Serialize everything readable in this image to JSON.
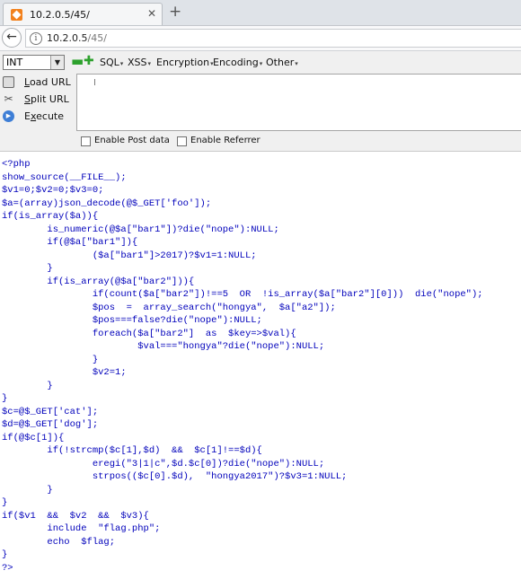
{
  "tab": {
    "title": "10.2.0.5/45/",
    "close_glyph": "✕",
    "new_tab_glyph": "+",
    "icon": "site-favicon"
  },
  "nav": {
    "back_glyph": "←",
    "info_glyph": "i",
    "url_host": "10.2.0.5",
    "url_path": "/45/"
  },
  "hackbar": {
    "select_value": "INT",
    "select_arrow": "▼",
    "minus_glyph": "▬",
    "plus_glyph": "✚",
    "menus": [
      {
        "label": "SQL",
        "caret": "▾"
      },
      {
        "label": "XSS",
        "caret": "▾"
      },
      {
        "label": "Encryption",
        "caret": "▾"
      },
      {
        "label": "Encoding",
        "caret": "▾"
      },
      {
        "label": "Other",
        "caret": "▾"
      }
    ],
    "load_url": {
      "u": "L",
      "rest": "oad URL"
    },
    "split_url": {
      "u": "S",
      "rest": "plit URL"
    },
    "execute": {
      "pre": "E",
      "u": "x",
      "rest": "ecute"
    },
    "exec_glyph": "▶",
    "split_glyph": "✂",
    "textarea_value": "",
    "caret_glyph": "I",
    "enable_post": "Enable Post data",
    "enable_referrer": "Enable Referrer"
  },
  "code": {
    "color": "#0000bb",
    "text": "<?php\nshow_source(__FILE__);\n$v1=0;$v2=0;$v3=0;\n$a=(array)json_decode(@$_GET['foo']);\nif(is_array($a)){\n        is_numeric(@$a[\"bar1\"])?die(\"nope\"):NULL;\n        if(@$a[\"bar1\"]){\n                ($a[\"bar1\"]>2017)?$v1=1:NULL;\n        }\n        if(is_array(@$a[\"bar2\"])){\n                if(count($a[\"bar2\"])!==5  OR  !is_array($a[\"bar2\"][0]))  die(\"nope\");\n                $pos  =  array_search(\"hongya\",  $a[\"a2\"]);\n                $pos===false?die(\"nope\"):NULL;\n                foreach($a[\"bar2\"]  as  $key=>$val){\n                        $val===\"hongya\"?die(\"nope\"):NULL;\n                }\n                $v2=1;\n        }\n}\n$c=@$_GET['cat'];\n$d=@$_GET['dog'];\nif(@$c[1]){\n        if(!strcmp($c[1],$d)  &&  $c[1]!==$d){\n                eregi(\"3|1|c\",$d.$c[0])?die(\"nope\"):NULL;\n                strpos(($c[0].$d),  \"hongya2017\")?$v3=1:NULL;\n        }\n}\nif($v1  &&  $v2  &&  $v3){\n        include  \"flag.php\";\n        echo  $flag;\n}\n?>"
  }
}
